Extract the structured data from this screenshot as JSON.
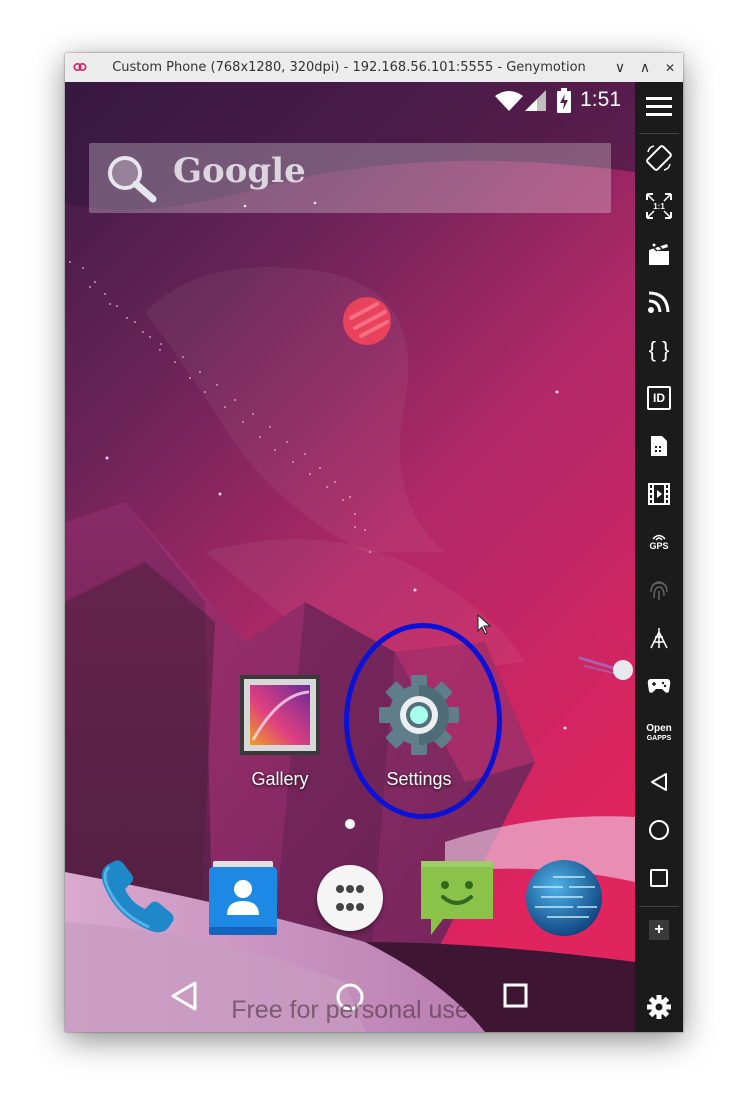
{
  "window": {
    "title": "Custom Phone (768x1280, 320dpi) - 192.168.56.101:5555 - Genymotion",
    "controls": [
      "minimize-chevron",
      "maximize-chevron",
      "close"
    ],
    "control_glyphs": {
      "minimize": "∨",
      "maximize": "∧",
      "close": "✕"
    }
  },
  "status_bar": {
    "time": "1:51",
    "icons": [
      "wifi-icon",
      "cell-signal-icon",
      "battery-charging-icon"
    ]
  },
  "search_widget": {
    "label": "Google"
  },
  "home_apps": [
    {
      "label": "Gallery",
      "icon": "gallery-icon"
    },
    {
      "label": "Settings",
      "icon": "settings-gear-icon"
    }
  ],
  "page_indicator": {
    "pages": 1,
    "current": 1
  },
  "dock": [
    {
      "icon": "phone-icon"
    },
    {
      "icon": "contacts-icon"
    },
    {
      "icon": "app-drawer-icon"
    },
    {
      "icon": "messaging-icon"
    },
    {
      "icon": "browser-globe-icon"
    }
  ],
  "nav_bar": [
    "back-icon",
    "home-icon",
    "recents-icon"
  ],
  "watermark": "Free for personal use",
  "sidebar": {
    "items": [
      {
        "icon": "menu-icon"
      },
      {
        "icon": "rotate-icon"
      },
      {
        "icon": "pixel-perfect-icon",
        "text": "1:1"
      },
      {
        "icon": "screencast-icon"
      },
      {
        "icon": "remote-control-icon"
      },
      {
        "icon": "shell-icon",
        "text": "{ }"
      },
      {
        "icon": "device-id-icon",
        "text": "ID"
      },
      {
        "icon": "sms-icon"
      },
      {
        "icon": "media-capture-icon"
      },
      {
        "icon": "gps-icon",
        "text": "GPS"
      },
      {
        "icon": "fingerprint-icon"
      },
      {
        "icon": "network-icon"
      },
      {
        "icon": "gamepad-icon"
      },
      {
        "icon": "open-gapps-icon",
        "text": "Open",
        "text2": "GAPPS"
      },
      {
        "icon": "nav-back-icon"
      },
      {
        "icon": "nav-home-icon"
      },
      {
        "icon": "nav-recents-icon"
      },
      {
        "icon": "plus-icon",
        "text": "+"
      },
      {
        "icon": "settings-icon"
      }
    ]
  },
  "annotation": {
    "shape": "ellipse",
    "color": "#0a12d8",
    "target": "Settings"
  },
  "colors": {
    "wallpaper_top": "#3a1a44",
    "wallpaper_mid": "#9a2a68",
    "wallpaper_pink": "#e0245e",
    "sidebar_bg": "#1b1b1b",
    "titlebar_bg": "#ececec"
  }
}
